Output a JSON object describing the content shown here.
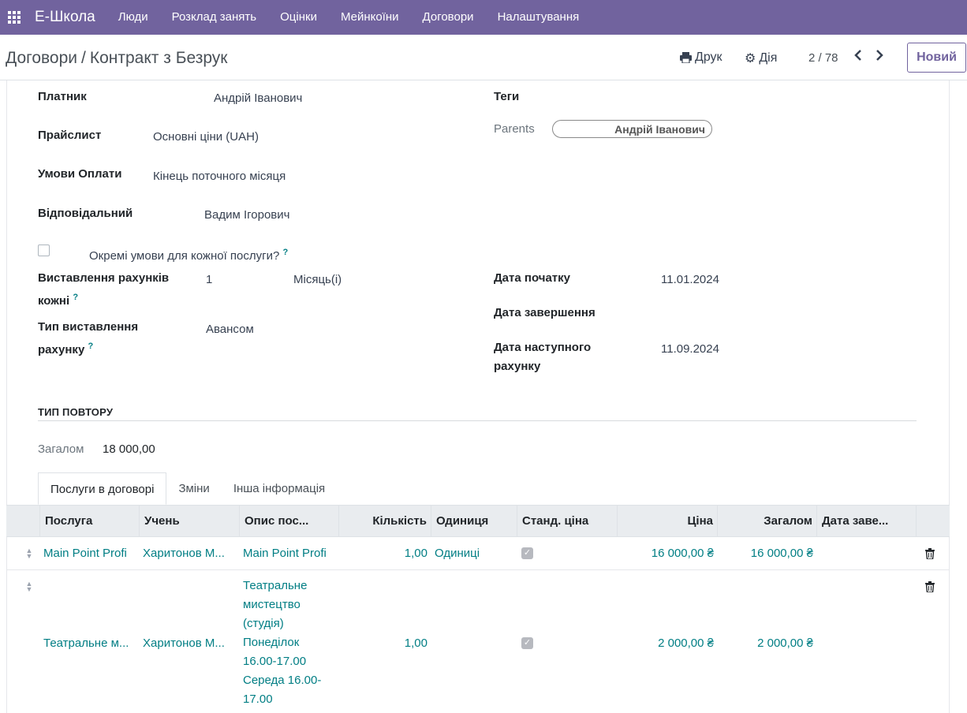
{
  "navbar": {
    "brand": "Е-Школа",
    "menu": [
      "Люди",
      "Розклад занять",
      "Оцінки",
      "Мейнкоїни",
      "Договори",
      "Налаштування"
    ]
  },
  "control": {
    "breadcrumb_parent": "Договори",
    "breadcrumb_sep": "/",
    "breadcrumb_current": "Контракт з Безрук",
    "print_label": "Друк",
    "action_label": "Дія",
    "pager": "2 / 78",
    "new_label": "Новий"
  },
  "form": {
    "payer_label": "Платник",
    "payer_value": "Андрій Іванович",
    "pricelist_label": "Прайслист",
    "pricelist_value": "Основні ціни (UAH)",
    "terms_label": "Умови Оплати",
    "terms_value": "Кінець поточного місяця",
    "responsible_label": "Відповідальний",
    "responsible_value": "Вадим Ігорович",
    "separate_terms_label": "Окремі умови для кожної послуги?",
    "billing_every_label_1": "Виставлення рахунків",
    "billing_every_label_2": "кожні",
    "billing_every_value": "1",
    "billing_every_unit": "Місяць(і)",
    "billing_type_label_1": "Тип виставлення",
    "billing_type_label_2": "рахунку",
    "billing_type_value": "Авансом",
    "tags_label": "Теги",
    "parents_label": "Parents",
    "parents_value": "Андрій Іванович",
    "start_label": "Дата початку",
    "start_value": "11.01.2024",
    "end_label": "Дата завершення",
    "next_label_1": "Дата наступного",
    "next_label_2": "рахунку",
    "next_value": "11.09.2024",
    "help_mark": "?",
    "repeat_section": "ТИП ПОВТОРУ",
    "total_label": "Загалом",
    "total_value": "18 000,00"
  },
  "tabs": [
    "Послуги в договорі",
    "Зміни",
    "Інша інформація"
  ],
  "table": {
    "headers": [
      "Послуга",
      "Учень",
      "Опис пос...",
      "Кількість",
      "Одиниця",
      "Станд. ціна",
      "Ціна",
      "Загалом",
      "Дата заве..."
    ],
    "rows": [
      {
        "service": "Main Point Profi",
        "student": "Харитонов М...",
        "description": [
          "Main Point Profi"
        ],
        "qty": "1,00",
        "unit": "Одиниці",
        "std_price": true,
        "price": "16 000,00 ₴",
        "total": "16 000,00 ₴"
      },
      {
        "service": "Театральне м...",
        "student": "Харитонов М...",
        "description": [
          "Театральне",
          "мистецтво",
          "(студія)",
          "Понеділок",
          "16.00-17.00",
          "Середа 16.00-",
          "17.00"
        ],
        "qty": "1,00",
        "unit": "",
        "std_price": true,
        "price": "2 000,00 ₴",
        "total": "2 000,00 ₴"
      }
    ]
  }
}
